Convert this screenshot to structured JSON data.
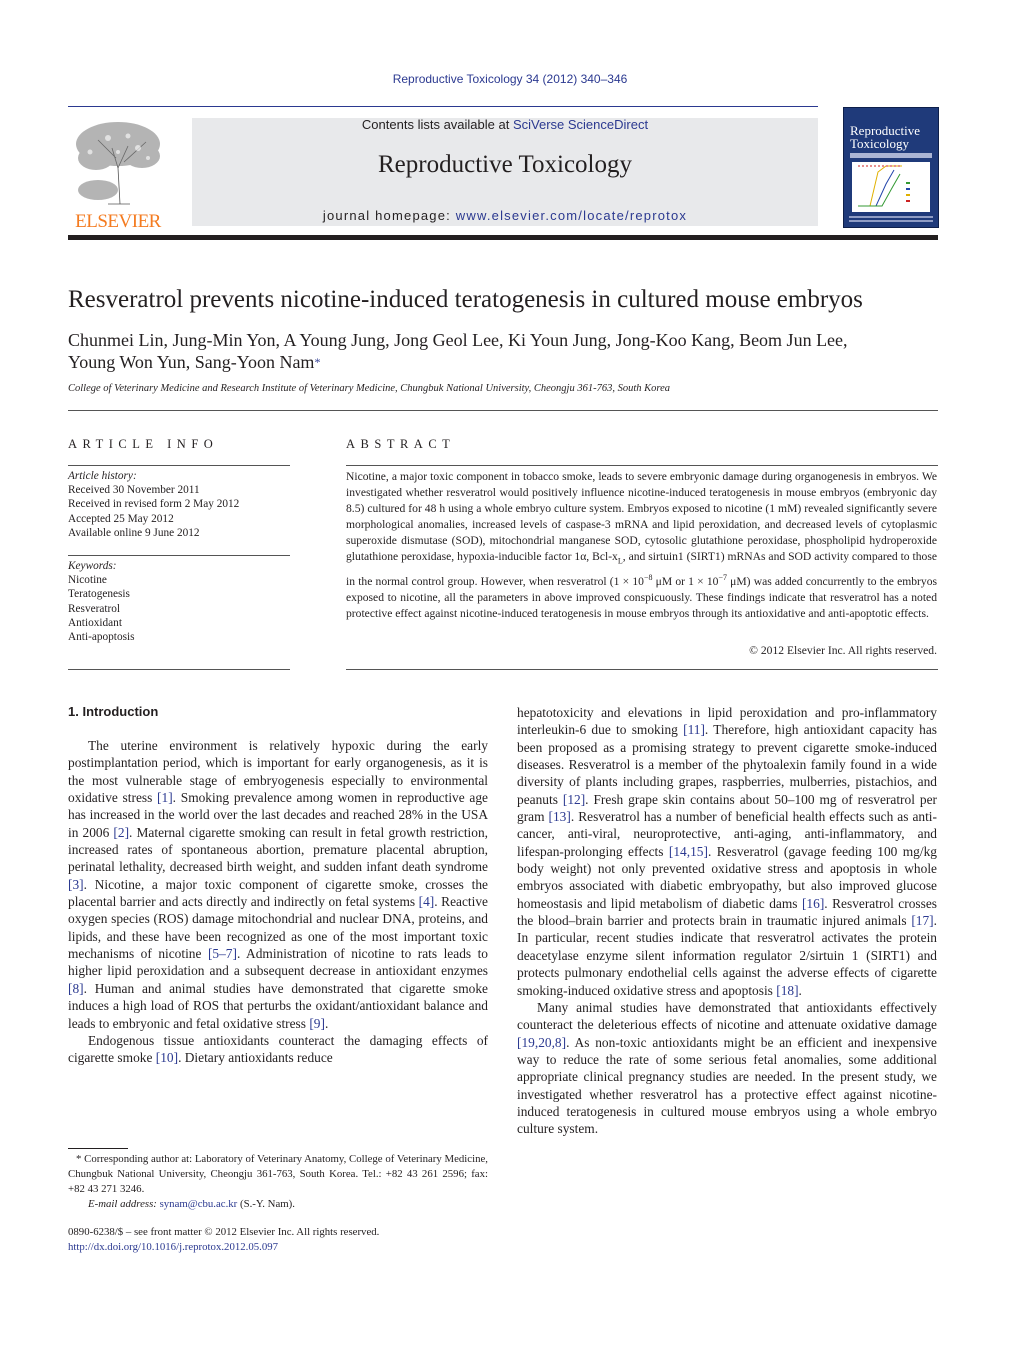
{
  "header": {
    "journal_ref": "Reproductive Toxicology 34 (2012) 340–346",
    "contents_prefix": "Contents lists available at ",
    "contents_link": "SciVerse ScienceDirect",
    "journal_title": "Reproductive Toxicology",
    "homepage_prefix": "journal homepage: ",
    "homepage_link": "www.elsevier.com/locate/reprotox",
    "publisher_logo_text": "ELSEVIER",
    "cover_title_line1": "Reproductive",
    "cover_title_line2": "Toxicology",
    "brand_color": "#f47b20",
    "link_color": "#2b3990"
  },
  "article": {
    "title": "Resveratrol prevents nicotine-induced teratogenesis in cultured mouse embryos",
    "authors_line1": "Chunmei Lin, Jung-Min Yon, A Young Jung, Jong Geol Lee, Ki Youn Jung, Jong-Koo Kang, Beom Jun Lee,",
    "authors_line2": "Young Won Yun, Sang-Yoon Nam",
    "corresponding_mark": "*",
    "affiliation": "College of Veterinary Medicine and Research Institute of Veterinary Medicine, Chungbuk National University, Cheongju 361-763, South Korea"
  },
  "article_info": {
    "heading": "ARTICLE INFO",
    "history_label": "Article history:",
    "history": [
      "Received 30 November 2011",
      "Received in revised form 2 May 2012",
      "Accepted 25 May 2012",
      "Available online 9 June 2012"
    ],
    "keywords_label": "Keywords:",
    "keywords": [
      "Nicotine",
      "Teratogenesis",
      "Resveratrol",
      "Antioxidant",
      "Anti-apoptosis"
    ]
  },
  "abstract": {
    "heading": "ABSTRACT",
    "text_part1": "Nicotine, a major toxic component in tobacco smoke, leads to severe embryonic damage during organogenesis in embryos. We investigated whether resveratrol would positively influence nicotine-induced teratogenesis in mouse embryos (embryonic day 8.5) cultured for 48 h using a whole embryo culture system. Embryos exposed to nicotine (1 mM) revealed significantly severe morphological anomalies, increased levels of caspase-3 mRNA and lipid peroxidation, and decreased levels of cytoplasmic superoxide dismutase (SOD), mitochondrial manganese SOD, cytosolic glutathione peroxidase, phospholipid hydroperoxide glutathione peroxidase, hypoxia-inducible factor 1α, Bcl-x",
    "subscript_L": "L",
    "text_part2": ", and sirtuin1 (SIRT1) mRNAs and SOD activity compared to those in the normal control group. However, when resveratrol (1 × 10",
    "exp1": "−8",
    "text_part3": " μM or 1 × 10",
    "exp2": "−7",
    "text_part4": " μM) was added concurrently to the embryos exposed to nicotine, all the parameters in above improved conspicuously. These findings indicate that resveratrol has a noted protective effect against nicotine-induced teratogenesis in mouse embryos through its antioxidative and anti-apoptotic effects.",
    "copyright": "© 2012 Elsevier Inc. All rights reserved."
  },
  "introduction": {
    "heading": "1.  Introduction",
    "col1_p1": [
      {
        "t": "The uterine environment is relatively hypoxic during the early postimplantation period, which is important for early organogenesis, as it is the most vulnerable stage of embryogenesis especially to environmental oxidative stress "
      },
      {
        "ref": "[1]"
      },
      {
        "t": ". Smoking prevalence among women in reproductive age has increased in the world over the last decades and reached 28% in the USA in 2006 "
      },
      {
        "ref": "[2]"
      },
      {
        "t": ". Maternal cigarette smoking can result in fetal growth restriction, increased rates of spontaneous abortion, premature placental abruption, perinatal lethality, decreased birth weight, and sudden infant death syndrome "
      },
      {
        "ref": "[3]"
      },
      {
        "t": ". Nicotine, a major toxic component of cigarette smoke, crosses the placental barrier and acts directly and indirectly on fetal systems "
      },
      {
        "ref": "[4]"
      },
      {
        "t": ". Reactive oxygen species (ROS) damage mitochondrial and nuclear DNA, proteins, and lipids, and these have been recognized as one of the most important toxic mechanisms of nicotine "
      },
      {
        "ref": "[5–7]"
      },
      {
        "t": ". Administration of nicotine to rats leads to higher lipid peroxidation and a subsequent decrease in antioxidant enzymes "
      },
      {
        "ref": "[8]"
      },
      {
        "t": ". Human and animal studies have demonstrated that cigarette smoke induces a high load of ROS that perturbs the oxidant/antioxidant balance and leads to embryonic and fetal oxidative stress "
      },
      {
        "ref": "[9]"
      },
      {
        "t": "."
      }
    ],
    "col1_p2": [
      {
        "t": "Endogenous tissue antioxidants counteract the damaging effects of cigarette smoke "
      },
      {
        "ref": "[10]"
      },
      {
        "t": ". Dietary antioxidants reduce"
      }
    ],
    "col2_p1": [
      {
        "t": "hepatotoxicity and elevations in lipid peroxidation and pro-inflammatory interleukin-6 due to smoking "
      },
      {
        "ref": "[11]"
      },
      {
        "t": ". Therefore, high antioxidant capacity has been proposed as a promising strategy to prevent cigarette smoke-induced diseases. Resveratrol is a member of the phytoalexin family found in a wide diversity of plants including grapes, raspberries, mulberries, pistachios, and peanuts "
      },
      {
        "ref": "[12]"
      },
      {
        "t": ". Fresh grape skin contains about 50–100 mg of resveratrol per gram "
      },
      {
        "ref": "[13]"
      },
      {
        "t": ". Resveratrol has a number of beneficial health effects such as anti-cancer, anti-viral, neuroprotective, anti-aging, anti-inflammatory, and lifespan-prolonging effects "
      },
      {
        "ref": "[14,15]"
      },
      {
        "t": ". Resveratrol (gavage feeding 100 mg/kg body weight) not only prevented oxidative stress and apoptosis in whole embryos associated with diabetic embryopathy, but also improved glucose homeostasis and lipid metabolism of diabetic dams "
      },
      {
        "ref": "[16]"
      },
      {
        "t": ". Resveratrol crosses the blood–brain barrier and protects brain in traumatic injured animals "
      },
      {
        "ref": "[17]"
      },
      {
        "t": ". In particular, recent studies indicate that resveratrol activates the protein deacetylase enzyme silent information regulator 2/sirtuin 1 (SIRT1) and protects pulmonary endothelial cells against the adverse effects of cigarette smoking-induced oxidative stress and apoptosis "
      },
      {
        "ref": "[18]"
      },
      {
        "t": "."
      }
    ],
    "col2_p2": [
      {
        "t": "Many animal studies have demonstrated that antioxidants effectively counteract the deleterious effects of nicotine and attenuate oxidative damage "
      },
      {
        "ref": "[19,20,8]"
      },
      {
        "t": ". As non-toxic antioxidants might be an efficient and inexpensive way to reduce the rate of some serious fetal anomalies, some additional appropriate clinical pregnancy studies are needed. In the present study, we investigated whether resveratrol has a protective effect against nicotine-induced teratogenesis in cultured mouse embryos using a whole embryo culture system."
      }
    ]
  },
  "footnote": {
    "corresponding": "* Corresponding author at: Laboratory of Veterinary Anatomy, College of Veterinary Medicine, Chungbuk National University, Cheongju 361-763, South Korea. Tel.: +82 43 261 2596; fax: +82 43 271 3246.",
    "email_label": "E-mail address: ",
    "email": "synam@cbu.ac.kr",
    "email_suffix": " (S.-Y. Nam).",
    "issn_line": "0890-6238/$ – see front matter © 2012 Elsevier Inc. All rights reserved.",
    "doi": "http://dx.doi.org/10.1016/j.reprotox.2012.05.097"
  }
}
